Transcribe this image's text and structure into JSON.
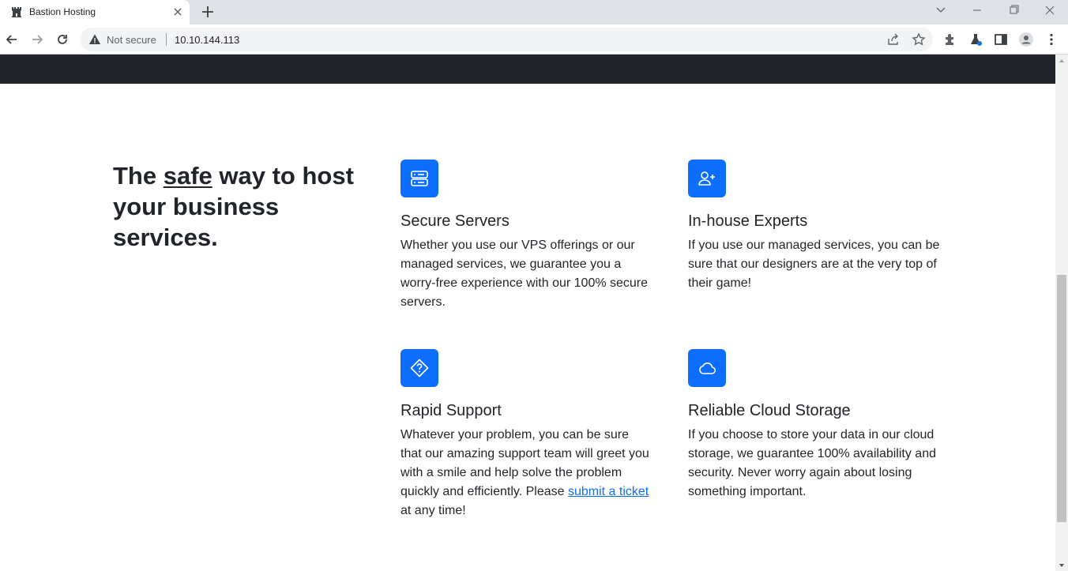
{
  "browser": {
    "tab_title": "Bastion Hosting",
    "security_label": "Not secure",
    "url": "10.10.144.113"
  },
  "hero": {
    "headline_pre": "The ",
    "headline_emph": "safe",
    "headline_post": " way to host your business services."
  },
  "features": [
    {
      "icon": "server-icon",
      "title": "Secure Servers",
      "text": "Whether you use our VPS offerings or our managed services, we guarantee you a worry-free experience with our 100% secure servers."
    },
    {
      "icon": "person-plus-icon",
      "title": "In-house Experts",
      "text": "If you use our managed services, you can be sure that our designers are at the very top of their game!"
    },
    {
      "icon": "question-diamond-icon",
      "title": "Rapid Support",
      "text_pre": "Whatever your problem, you can be sure that our amazing support team will greet you with a smile and help solve the problem quickly and efficiently. Please ",
      "link": "submit a ticket",
      "text_post": " at any time!"
    },
    {
      "icon": "cloud-icon",
      "title": "Reliable Cloud Storage",
      "text": "If you choose to store your data in our cloud storage, we guarantee 100% availability and security. Never worry again about losing something important."
    }
  ],
  "colors": {
    "accent": "#0d6efd",
    "navbar": "#212529"
  }
}
